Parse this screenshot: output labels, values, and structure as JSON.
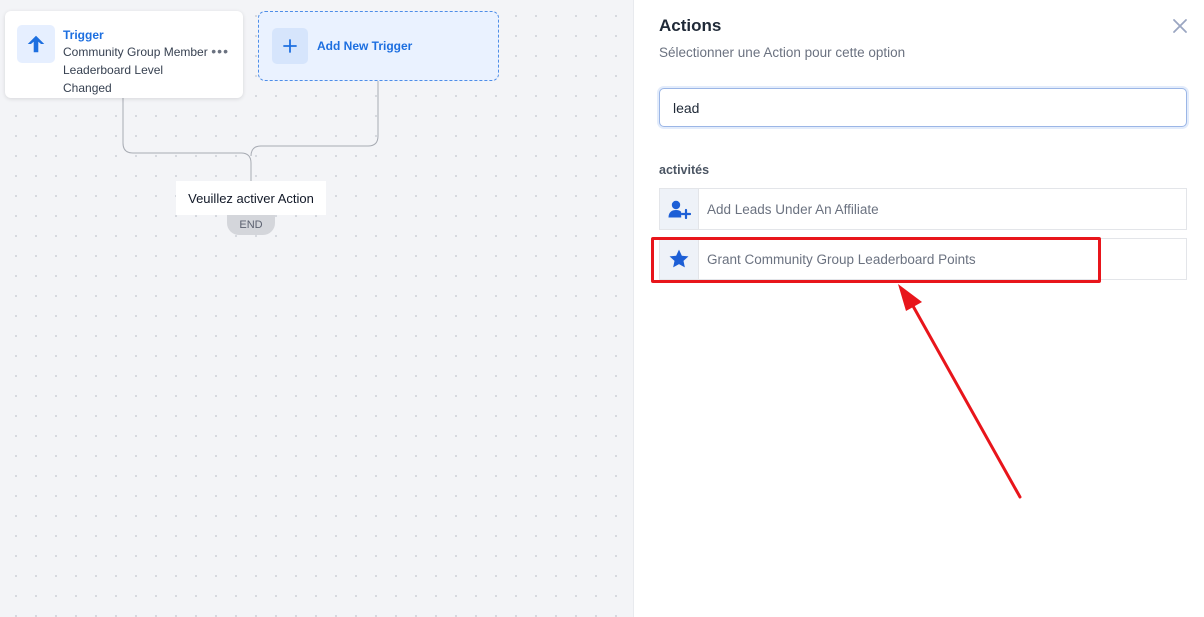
{
  "canvas": {
    "trigger_card": {
      "title": "Trigger",
      "description": "Community Group Member Leaderboard Level Changed",
      "icon": "arrow-up-icon",
      "more": "•••"
    },
    "add_trigger": {
      "label": "Add New Trigger",
      "icon": "plus-icon"
    },
    "activate_action": "Veuillez activer Action",
    "end_label": "END"
  },
  "panel": {
    "title": "Actions",
    "subtitle": "Sélectionner une Action pour cette option",
    "close_icon": "close-icon",
    "search": {
      "value": "lead",
      "placeholder": ""
    },
    "section_label": "activités",
    "items": [
      {
        "label": "Add Leads Under An Affiliate",
        "icon": "user-plus-icon"
      },
      {
        "label": "Grant Community Group Leaderboard Points",
        "icon": "star-icon"
      }
    ]
  },
  "colors": {
    "accent": "#1d6fe0",
    "highlight": "#e8151b",
    "canvas_bg": "#f3f4f7"
  }
}
